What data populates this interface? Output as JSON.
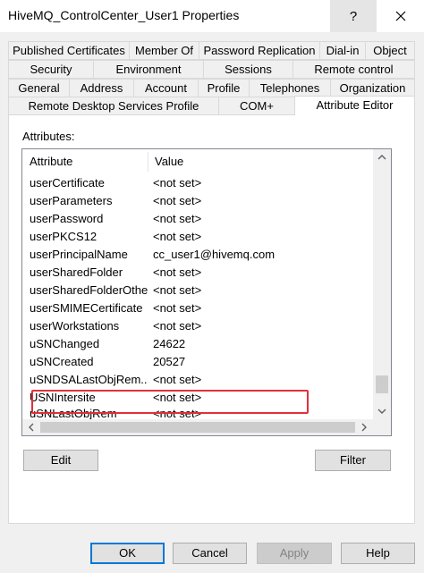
{
  "window": {
    "title": "HiveMQ_ControlCenter_User1 Properties",
    "help_glyph": "?",
    "close_icon": "close-icon"
  },
  "tabs": {
    "row1": [
      "Published Certificates",
      "Member Of",
      "Password Replication",
      "Dial-in",
      "Object"
    ],
    "row2": [
      "Security",
      "Environment",
      "Sessions",
      "Remote control"
    ],
    "row3": [
      "General",
      "Address",
      "Account",
      "Profile",
      "Telephones",
      "Organization"
    ],
    "row4": [
      "Remote Desktop Services Profile",
      "COM+",
      "Attribute Editor"
    ],
    "active": "Attribute Editor"
  },
  "attributes": {
    "caption": "Attributes:",
    "columns": [
      "Attribute",
      "Value"
    ],
    "rows": [
      {
        "name": "userCertificate",
        "value": "<not set>"
      },
      {
        "name": "userParameters",
        "value": "<not set>"
      },
      {
        "name": "userPassword",
        "value": "<not set>"
      },
      {
        "name": "userPKCS12",
        "value": "<not set>"
      },
      {
        "name": "userPrincipalName",
        "value": "cc_user1@hivemq.com"
      },
      {
        "name": "userSharedFolder",
        "value": "<not set>"
      },
      {
        "name": "userSharedFolderOther",
        "value": "<not set>"
      },
      {
        "name": "userSMIMECertificate",
        "value": "<not set>"
      },
      {
        "name": "userWorkstations",
        "value": "<not set>"
      },
      {
        "name": "uSNChanged",
        "value": "24622"
      },
      {
        "name": "uSNCreated",
        "value": "20527"
      },
      {
        "name": "uSNDSALastObjRem...",
        "value": "<not set>"
      },
      {
        "name": "USNIntersite",
        "value": "<not set>"
      },
      {
        "name": "uSNLastObjRem",
        "value": "<not set>"
      }
    ],
    "highlighted_row": "userPrincipalName",
    "highlight_color": "#e0303a"
  },
  "actions": {
    "edit": "Edit",
    "filter": "Filter"
  },
  "footer": {
    "ok": "OK",
    "cancel": "Cancel",
    "apply": "Apply",
    "help": "Help"
  },
  "colors": {
    "dialog_bg": "#f0f0f0",
    "default_button_border": "#0078d7"
  }
}
